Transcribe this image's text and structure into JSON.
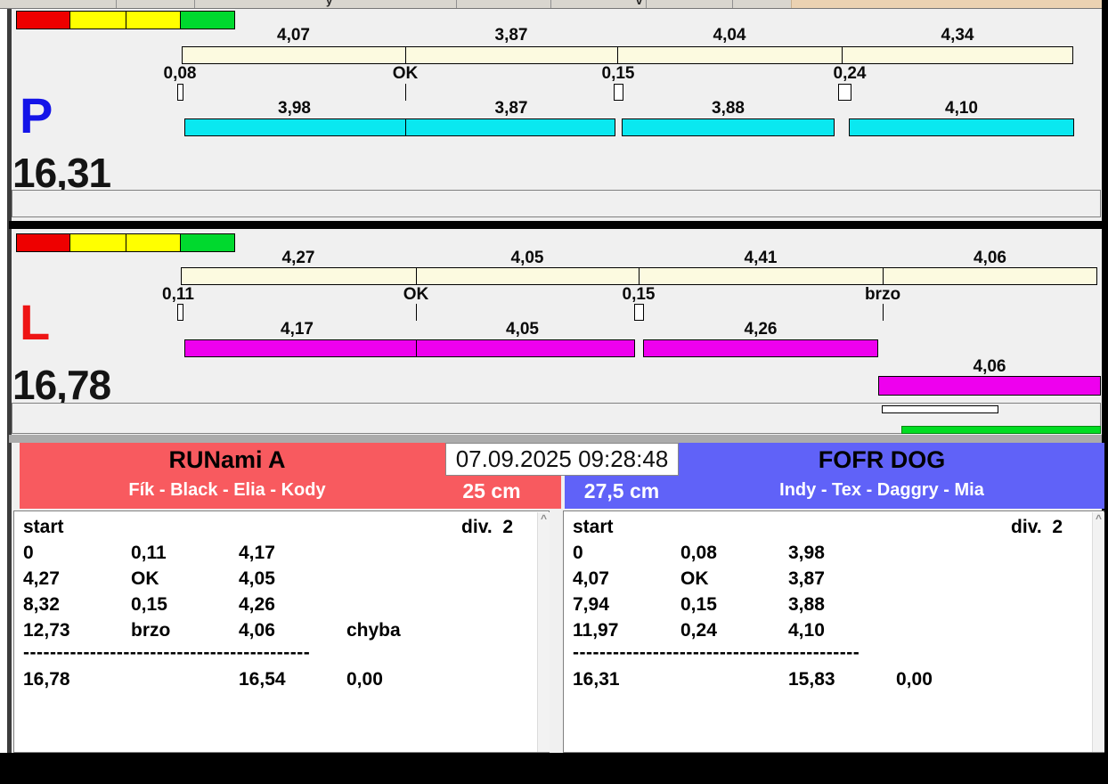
{
  "timestamp": "07.09.2025 09:28:48",
  "colors": {
    "lane_p_bar": "#0AE8F0",
    "lane_l_bar": "#EE00EE",
    "segment_bar_bg": "#FCFAE0",
    "traffic_red": "#EE0000",
    "traffic_yellow": "#FFFF00",
    "traffic_green": "#00D92E",
    "team_left_bg": "#F85A5F",
    "team_right_bg": "#6062F8",
    "lane_p_letter": "#1414E8",
    "lane_l_letter": "#EE1414",
    "progress_green": "#00DD22"
  },
  "lane_p": {
    "letter": "P",
    "total": "16,31",
    "top_times": [
      "4,07",
      "3,87",
      "4,04",
      "4,34"
    ],
    "marks": [
      "0,08",
      "OK",
      "0,15",
      "0,24"
    ],
    "bottom_times": [
      "3,98",
      "3,87",
      "3,88",
      "4,10"
    ]
  },
  "lane_l": {
    "letter": "L",
    "total": "16,78",
    "top_times": [
      "4,27",
      "4,05",
      "4,41",
      "4,06"
    ],
    "marks": [
      "0,11",
      "OK",
      "0,15",
      "brzo"
    ],
    "bottom_times": [
      "4,17",
      "4,05",
      "4,26",
      "4,06"
    ]
  },
  "team_left": {
    "name": "RUNami A",
    "dogs": "Fík - Black - Elia - Kody",
    "jump_height": "25 cm",
    "table": {
      "start_label": "start",
      "division_label": "div.  2",
      "rows": [
        {
          "c1": "0",
          "c2": "0,11",
          "c3": "4,17",
          "c4": ""
        },
        {
          "c1": "4,27",
          "c2": "OK",
          "c3": "4,05",
          "c4": ""
        },
        {
          "c1": "8,32",
          "c2": "0,15",
          "c3": "4,26",
          "c4": ""
        },
        {
          "c1": "12,73",
          "c2": "brzo",
          "c3": "4,06",
          "c4": "chyba"
        }
      ],
      "separator": "-------------------------------------------",
      "total_time": "16,78",
      "clean_time": "16,54",
      "penalty": "0,00"
    }
  },
  "team_right": {
    "name": "FOFR DOG",
    "dogs": "Indy - Tex - Daggry - Mia",
    "jump_height": "27,5 cm",
    "table": {
      "start_label": "start",
      "division_label": "div.  2",
      "rows": [
        {
          "c1": "0",
          "c2": "0,08",
          "c3": "3,98",
          "c4": ""
        },
        {
          "c1": "4,07",
          "c2": "OK",
          "c3": "3,87",
          "c4": ""
        },
        {
          "c1": "7,94",
          "c2": "0,15",
          "c3": "3,88",
          "c4": ""
        },
        {
          "c1": "11,97",
          "c2": "0,24",
          "c3": "4,10",
          "c4": ""
        }
      ],
      "separator": "-------------------------------------------",
      "total_time": "16,31",
      "clean_time": "15,83",
      "penalty": "0,00"
    }
  },
  "scrollbar_up_glyph": "^"
}
